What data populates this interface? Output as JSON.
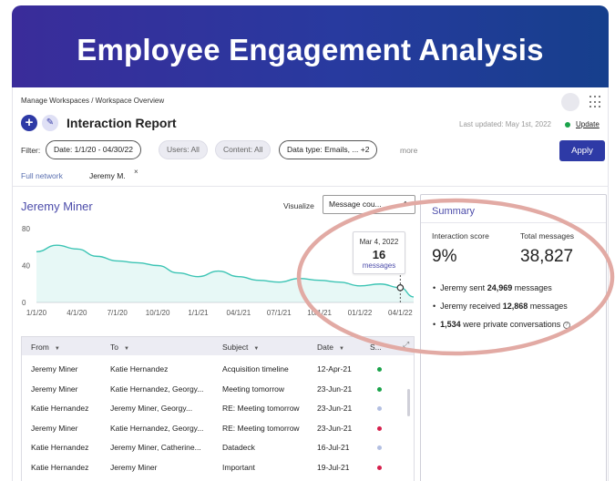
{
  "banner": {
    "title": "Employee Engagement Analysis"
  },
  "breadcrumb": "Manage Workspaces / Workspace Overview",
  "header": {
    "title": "Interaction Report",
    "last_updated": "Last updated: May 1st, 2022",
    "update_label": "Update"
  },
  "filters": {
    "label": "Filter:",
    "chips": [
      "Date: 1/1/20 - 04/30/22",
      "Users: All",
      "Content: All",
      "Data type: Emails, ... +2"
    ],
    "more_label": "more",
    "apply_label": "Apply"
  },
  "tabs": [
    "Full network",
    "Jeremy M."
  ],
  "tab_close": "×",
  "panel": {
    "person": "Jeremy Miner",
    "visualize_label": "Visualize",
    "visualize_value": "Message cou..."
  },
  "chart_data": {
    "type": "area",
    "x_tick_labels": [
      "1/1/20",
      "4/1/20",
      "7/1/20",
      "10/1/20",
      "1/1/21",
      "04/1/21",
      "07/1/21",
      "10/1/21",
      "01/1/22",
      "04/1/22"
    ],
    "y_tick_labels": [
      "80",
      "40",
      "0"
    ],
    "ylim": [
      0,
      80
    ],
    "x": [
      0,
      0.5,
      1,
      1.5,
      2,
      2.5,
      3,
      3.5,
      4,
      4.5,
      5,
      5.5,
      6,
      6.5,
      7,
      7.5,
      8,
      8.5,
      9,
      9.33
    ],
    "values": [
      55,
      62,
      58,
      50,
      45,
      43,
      40,
      32,
      28,
      34,
      28,
      24,
      22,
      26,
      24,
      22,
      18,
      20,
      16,
      6
    ],
    "color": "#3cc4b4",
    "tooltip": {
      "date": "Mar 4, 2022",
      "value": "16",
      "unit": "messages",
      "x": 9.0
    }
  },
  "table": {
    "columns": [
      "From",
      "To",
      "Subject",
      "Date",
      "S..."
    ],
    "rows": [
      {
        "from": "Jeremy Miner",
        "to": "Katie Hernandez",
        "subject": "Acquisition timeline",
        "date": "12-Apr-21",
        "status": "#1aa34a"
      },
      {
        "from": "Jeremy Miner",
        "to": "Katie Hernandez, Georgy...",
        "subject": "Meeting tomorrow",
        "date": "23-Jun-21",
        "status": "#1aa34a"
      },
      {
        "from": "Katie Hernandez",
        "to": "Jeremy Miner, Georgy...",
        "subject": "RE: Meeting tomorrow",
        "date": "23-Jun-21",
        "status": "#b3bfe2"
      },
      {
        "from": "Jeremy Miner",
        "to": "Katie Hernandez, Georgy...",
        "subject": "RE: Meeting tomorrow",
        "date": "23-Jun-21",
        "status": "#d61f4c"
      },
      {
        "from": "Katie Hernandez",
        "to": "Jeremy Miner, Catherine...",
        "subject": "Datadeck",
        "date": "16-Jul-21",
        "status": "#b3bfe2"
      },
      {
        "from": "Katie Hernandez",
        "to": "Jeremy Miner",
        "subject": "Important",
        "date": "19-Jul-21",
        "status": "#d61f4c"
      }
    ]
  },
  "summary": {
    "title": "Summary",
    "interaction_score_label": "Interaction score",
    "interaction_score": "9%",
    "total_messages_label": "Total messages",
    "total_messages": "38,827",
    "bullets": [
      {
        "pre": "Jeremy sent ",
        "bold": "24,969",
        "post": " messages"
      },
      {
        "pre": "Jeremy received ",
        "bold": "12,868",
        "post": " messages"
      },
      {
        "pre": "",
        "bold": "1,534",
        "post": " were private conversations"
      }
    ]
  },
  "colors": {
    "accent": "#2e3aa6",
    "highlight_ellipse": "#e2aaa4"
  }
}
